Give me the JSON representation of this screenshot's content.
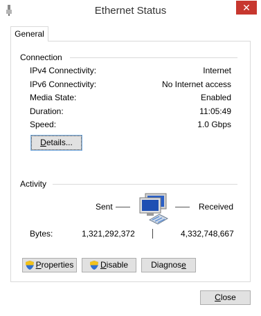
{
  "window": {
    "title": "Ethernet Status",
    "close_glyph": "✕"
  },
  "tabs": [
    {
      "label": "General"
    }
  ],
  "connection": {
    "heading": "Connection",
    "rows": [
      {
        "label": "IPv4 Connectivity:",
        "value": "Internet"
      },
      {
        "label": "IPv6 Connectivity:",
        "value": "No Internet access"
      },
      {
        "label": "Media State:",
        "value": "Enabled"
      },
      {
        "label": "Duration:",
        "value": "11:05:49"
      },
      {
        "label": "Speed:",
        "value": "1.0 Gbps"
      }
    ],
    "details_button": {
      "prefix": "",
      "accel": "D",
      "suffix": "etails..."
    }
  },
  "activity": {
    "heading": "Activity",
    "sent_label": "Sent",
    "received_label": "Received",
    "bytes_label": "Bytes:",
    "bytes_sent": "1,321,292,372",
    "bytes_received": "4,332,748,667"
  },
  "buttons": {
    "properties": {
      "accel": "P",
      "rest": "roperties"
    },
    "disable": {
      "accel": "D",
      "rest": "isable"
    },
    "diagnose": {
      "pre": "Diagnos",
      "accel": "e",
      "post": ""
    },
    "close": {
      "accel": "C",
      "rest": "lose"
    }
  },
  "colors": {
    "close_red": "#c7372f",
    "shield_blue": "#2f6fd1",
    "shield_yellow": "#f2c21b"
  }
}
